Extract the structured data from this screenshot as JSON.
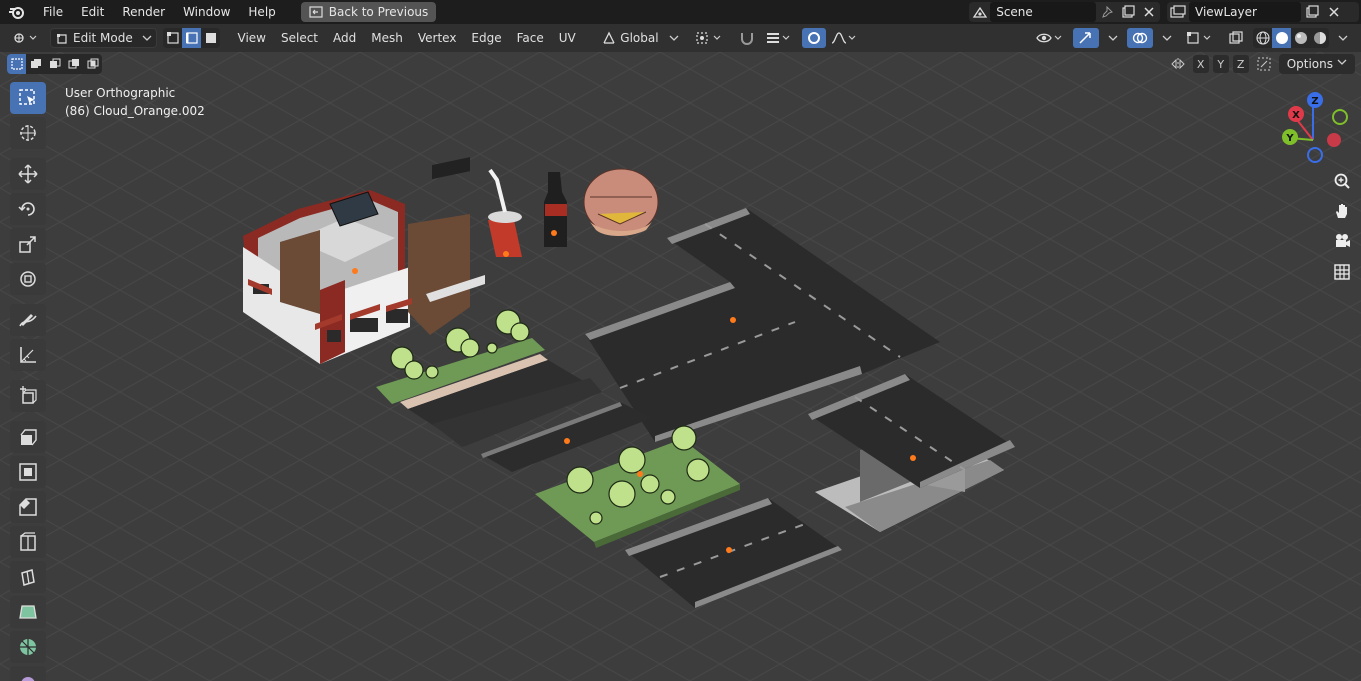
{
  "menu": {
    "items": [
      "File",
      "Edit",
      "Render",
      "Window",
      "Help"
    ],
    "back_label": "Back to Previous",
    "scene": "Scene",
    "view_layer": "ViewLayer"
  },
  "header": {
    "mode": "Edit Mode",
    "menus": [
      "View",
      "Select",
      "Add",
      "Mesh",
      "Vertex",
      "Edge",
      "Face",
      "UV"
    ],
    "transform_orientation": "Global"
  },
  "viewport": {
    "view_name": "User Orthographic",
    "object_info": "(86) Cloud_Orange.002",
    "options_label": "Options",
    "axes": [
      "X",
      "Y",
      "Z"
    ],
    "gizmo": {
      "x": "X",
      "y": "Y",
      "z": "Z"
    }
  },
  "toolbar": {
    "tools": [
      "select-box-icon",
      "cursor-icon",
      "move-icon",
      "rotate-icon",
      "scale-icon",
      "transform-icon",
      "annotate-icon",
      "measure-icon",
      "add-cube-icon",
      "extrude-icon",
      "inset-icon",
      "bevel-icon",
      "loop-cut-icon",
      "knife-icon",
      "poly-build-icon",
      "spin-icon",
      "smooth-icon"
    ]
  },
  "colors": {
    "accent": "#4772b3",
    "viewport_bg": "#3d3d3d",
    "grass": "#6f9a55",
    "road": "#2f2f2f",
    "building_red": "#8a2a22"
  }
}
